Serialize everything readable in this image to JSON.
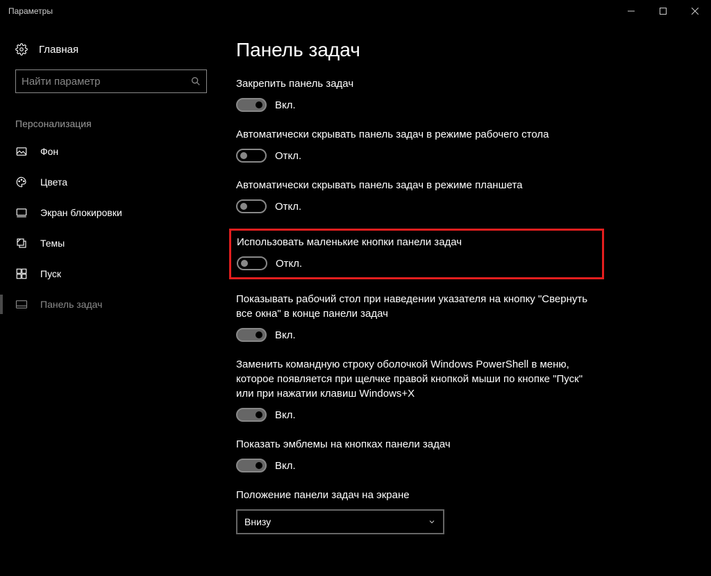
{
  "window": {
    "title": "Параметры"
  },
  "sidebar": {
    "home": "Главная",
    "search_placeholder": "Найти параметр",
    "category": "Персонализация",
    "items": [
      {
        "label": "Фон"
      },
      {
        "label": "Цвета"
      },
      {
        "label": "Экран блокировки"
      },
      {
        "label": "Темы"
      },
      {
        "label": "Пуск"
      },
      {
        "label": "Панель задач"
      }
    ]
  },
  "main": {
    "title": "Панель задач",
    "state_on": "Вкл.",
    "state_off": "Откл.",
    "settings": [
      {
        "label": "Закрепить панель задач",
        "value": true
      },
      {
        "label": "Автоматически скрывать панель задач в режиме рабочего стола",
        "value": false
      },
      {
        "label": "Автоматически скрывать панель задач в режиме планшета",
        "value": false
      },
      {
        "label": "Использовать маленькие кнопки панели задач",
        "value": false,
        "highlighted": true
      },
      {
        "label": "Показывать рабочий стол при наведении указателя на кнопку \"Свернуть все окна\" в конце панели задач",
        "value": true
      },
      {
        "label": "Заменить командную строку оболочкой Windows PowerShell в меню, которое появляется при щелчке правой кнопкой мыши по кнопке \"Пуск\" или при нажатии клавиш Windows+X",
        "value": true
      },
      {
        "label": "Показать эмблемы на кнопках панели задач",
        "value": true
      }
    ],
    "position": {
      "label": "Положение панели задач на экране",
      "value": "Внизу"
    }
  }
}
